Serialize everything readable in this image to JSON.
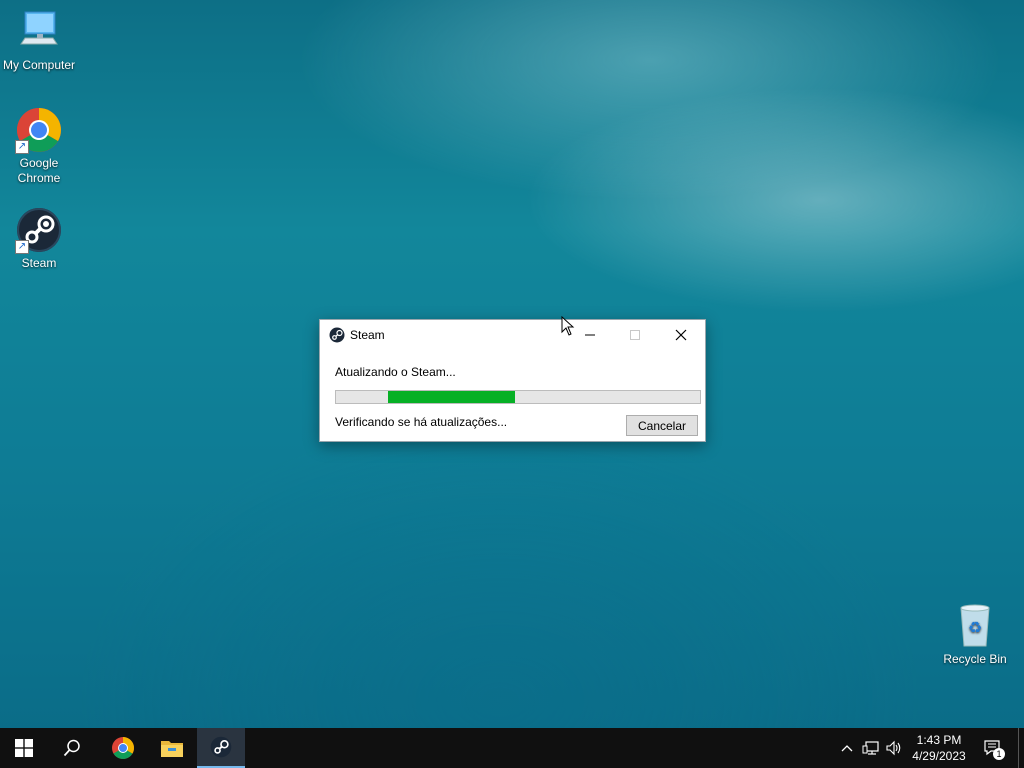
{
  "desktop": {
    "icons": [
      {
        "label": "My Computer"
      },
      {
        "label": "Google Chrome"
      },
      {
        "label": "Steam"
      },
      {
        "label": "Recycle Bin"
      }
    ]
  },
  "dialog": {
    "title": "Steam",
    "status": "Atualizando o Steam...",
    "progress_percent": 35,
    "substatus": "Verificando se há atualizações...",
    "cancel_label": "Cancelar",
    "progress_color": "#06b025"
  },
  "taskbar": {
    "pinned": [
      {
        "icon": "windows-start-icon"
      },
      {
        "icon": "search-icon"
      },
      {
        "icon": "chrome-icon"
      },
      {
        "icon": "file-explorer-icon"
      },
      {
        "icon": "steam-icon",
        "active": true
      }
    ],
    "clock": {
      "time": "1:43 PM",
      "date": "4/29/2023"
    },
    "notification_count": "1"
  }
}
